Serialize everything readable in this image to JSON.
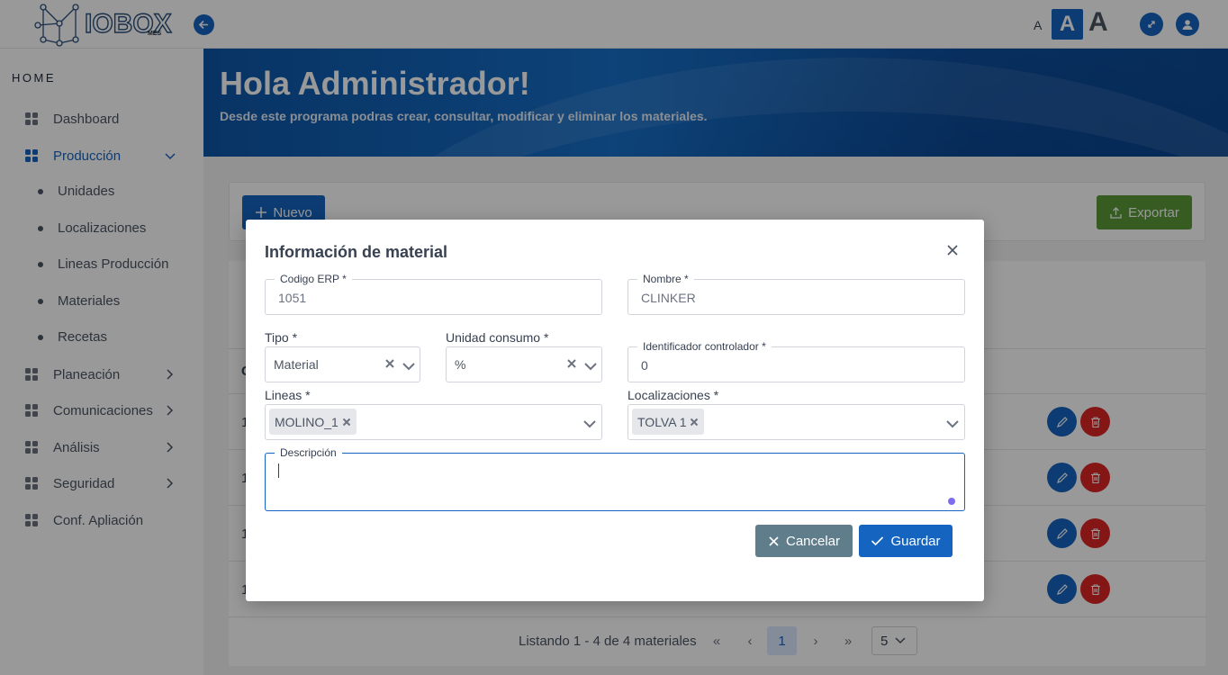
{
  "app": {
    "logo_text": "IOBOX",
    "logo_sub": "MES"
  },
  "font_size_controls": {
    "small": "A",
    "medium": "A",
    "large": "A"
  },
  "sidebar": {
    "section": "HOME",
    "items": [
      {
        "label": "Dashboard"
      },
      {
        "label": "Producción",
        "expanded": true,
        "active": true
      },
      {
        "label": "Planeación"
      },
      {
        "label": "Comunicaciones"
      },
      {
        "label": "Análisis"
      },
      {
        "label": "Seguridad"
      },
      {
        "label": "Conf. Apliación"
      }
    ],
    "sub_items": [
      {
        "label": "Unidades"
      },
      {
        "label": "Localizaciones"
      },
      {
        "label": "Lineas Producción"
      },
      {
        "label": "Materiales"
      },
      {
        "label": "Recetas"
      }
    ]
  },
  "banner": {
    "title": "Hola Administrador!",
    "subtitle": "Desde este programa podras crear, consultar, modificar y eliminar los materiales."
  },
  "toolbar": {
    "new_label": "Nuevo",
    "export_label": "Exportar"
  },
  "table": {
    "header_partial": "C",
    "rows": [
      {
        "id_partial": "1"
      },
      {
        "id_partial": "1"
      },
      {
        "id_partial": "1"
      },
      {
        "id_partial": "1"
      }
    ]
  },
  "pagination": {
    "summary": "Listando 1 - 4 de 4 materiales",
    "current_page": "1",
    "page_size": "5",
    "first": "«",
    "prev": "‹",
    "next": "›",
    "last": "»"
  },
  "modal": {
    "title": "Información de material",
    "fields": {
      "codigo_erp": {
        "label": "Codigo ERP *",
        "value": "1051"
      },
      "nombre": {
        "label": "Nombre *",
        "value": "CLINKER"
      },
      "tipo": {
        "label": "Tipo *",
        "value": "Material"
      },
      "unidad_consumo": {
        "label": "Unidad consumo *",
        "value": "%"
      },
      "identificador": {
        "label": "Identificador controlador *",
        "value": "0"
      },
      "lineas": {
        "label": "Lineas *",
        "chip": "MOLINO_1"
      },
      "localizaciones": {
        "label": "Localizaciones *",
        "chip": "TOLVA 1"
      },
      "descripcion": {
        "label": "Descripción",
        "value": ""
      }
    },
    "cancel_label": "Cancelar",
    "save_label": "Guardar"
  },
  "colors": {
    "primary": "#1565c0",
    "export": "#5a9a3a",
    "danger": "#dc2626",
    "cancel": "#607d8b"
  }
}
